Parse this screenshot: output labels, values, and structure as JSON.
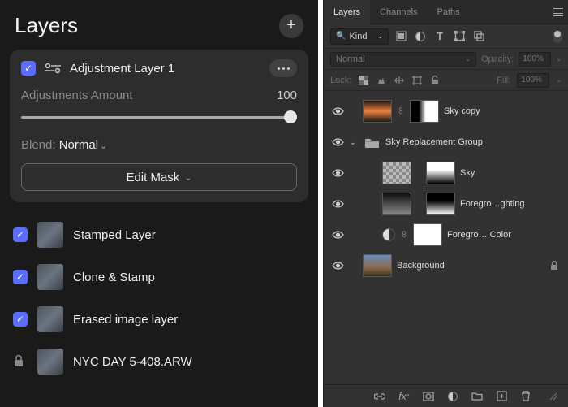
{
  "left": {
    "title": "Layers",
    "adjustment": {
      "name": "Adjustment Layer 1",
      "amount_label": "Adjustments Amount",
      "amount_value": "100",
      "blend_label": "Blend:",
      "blend_mode": "Normal",
      "mask_btn": "Edit Mask"
    },
    "layers": [
      {
        "checked": true,
        "name": "Stamped Layer"
      },
      {
        "checked": true,
        "name": "Clone & Stamp"
      },
      {
        "checked": true,
        "name": "Erased image layer"
      },
      {
        "locked": true,
        "name": "NYC DAY 5-408.ARW"
      }
    ]
  },
  "right": {
    "tabs": [
      "Layers",
      "Channels",
      "Paths"
    ],
    "active_tab": "Layers",
    "filter": {
      "kind_label": "Kind"
    },
    "blend": {
      "mode": "Normal",
      "opacity_label": "Opacity:",
      "opacity_value": "100%"
    },
    "lock": {
      "label": "Lock:",
      "fill_label": "Fill:",
      "fill_value": "100%"
    },
    "layers": [
      {
        "name": "Sky copy",
        "type": "layer",
        "linked": true,
        "indent": 0
      },
      {
        "name": "Sky Replacement Group",
        "type": "group",
        "expanded": true,
        "indent": 0
      },
      {
        "name": "Sky",
        "type": "masked",
        "indent": 1
      },
      {
        "name": "Foregro…ghting",
        "type": "masked",
        "indent": 1
      },
      {
        "name": "Foregro… Color",
        "type": "adjust",
        "linked": true,
        "indent": 1
      },
      {
        "name": "Background",
        "type": "bg",
        "locked": true,
        "indent": 0
      }
    ]
  }
}
